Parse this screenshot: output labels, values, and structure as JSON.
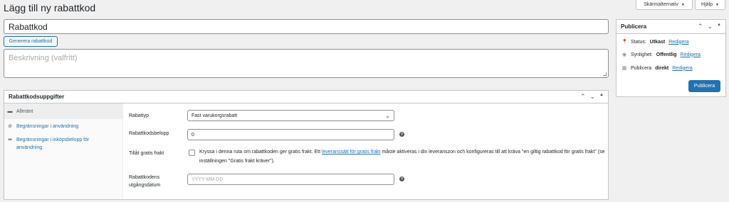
{
  "header": {
    "title": "Lägg till ny rabattkod",
    "screen_options_label": "Skärmalternativ",
    "help_label": "Hjälp"
  },
  "coupon": {
    "code_value": "Rabattkod",
    "generate_label": "Generera rabattkod",
    "description_placeholder": "Beskrivning (valfritt)"
  },
  "data_box": {
    "title": "Rabattkodsuppgifter",
    "tabs": [
      {
        "label": "Allmänt",
        "icon": "ticket-icon"
      },
      {
        "label": "Begränsningar i användning",
        "icon": "blocked-icon"
      },
      {
        "label": "Begränsningar i inköpsbelopp för användning",
        "icon": "arrows-icon"
      }
    ],
    "fields": {
      "discount_type_label": "Rabattyp",
      "discount_type_value": "Fast varukorgsrabatt",
      "amount_label": "Rabattkodsbelopp",
      "amount_value": "0",
      "free_shipping_label": "Tillåt gratis frakt",
      "free_shipping_text_before": "Kryssa i denna ruta om rabattkoden ger gratis frakt. Ett ",
      "free_shipping_link": "leveranssätt för gratis frakt",
      "free_shipping_text_after": " måste aktiveras i din leveranszon och konfigureras till att kräva \"en giltig rabattkod för gratis frakt\" (se inställningen \"Gratis frakt kräver\").",
      "expiry_label": "Rabattkodens utgångsdatum",
      "expiry_placeholder": "YYYY-MM-DD"
    }
  },
  "publish": {
    "title": "Publicera",
    "status_label": "Status:",
    "status_value": "Utkast",
    "visibility_label": "Synlighet:",
    "visibility_value": "Offentlig",
    "publish_label": "Publicera",
    "publish_value": "direkt",
    "edit_link": "Redigera",
    "button_label": "Publicera"
  },
  "colors": {
    "accent": "#2271b1",
    "background": "#f0f0f1"
  }
}
